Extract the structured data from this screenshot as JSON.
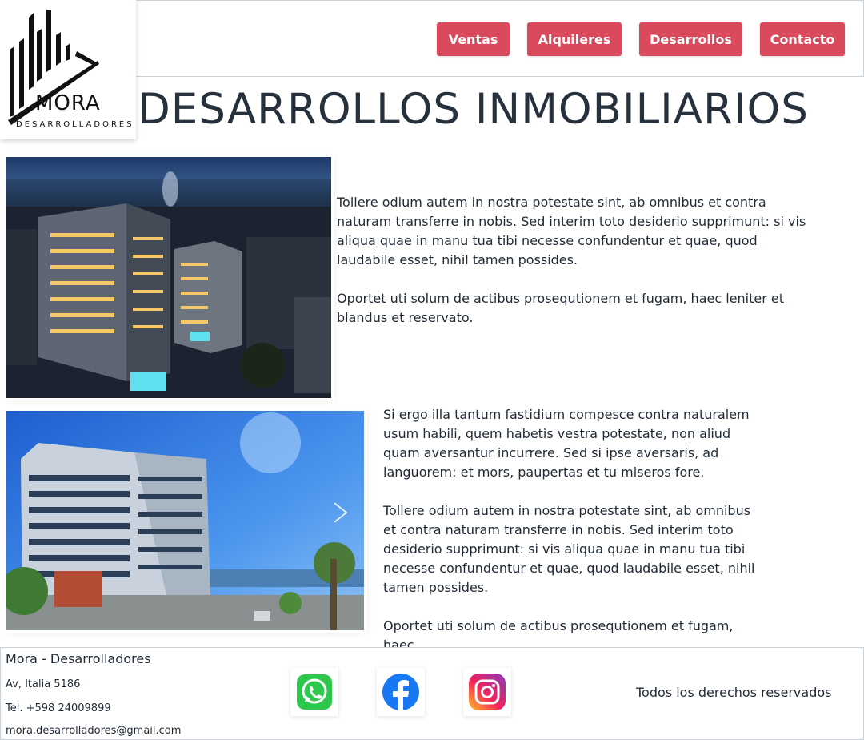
{
  "brand": {
    "name": "MORA",
    "tagline": "DESARROLLADORES"
  },
  "nav": {
    "items": [
      "Ventas",
      "Alquileres",
      "Desarrollos",
      "Contacto"
    ]
  },
  "page": {
    "title": "DESARROLLOS INMOBILIARIOS"
  },
  "content": {
    "p1": "Tollere odium autem in nostra potestate sint, ab omnibus et contra naturam transferre in nobis. Sed interim toto desiderio supprimunt: si vis aliqua quae in manu tua tibi necesse confundentur et quae, quod laudabile esset, nihil tamen possides.",
    "p2": "Oportet uti solum de actibus prosequtionem et fugam, haec leniter et blandus et reservato.",
    "p3": "Si ergo illa tantum fastidium compesce contra naturalem usum habili, quem habetis vestra potestate, non aliud quam aversantur incurrere. Sed si ipse aversaris, ad languorem: et mors, paupertas et tu miseros fore.",
    "p4": "Tollere odium autem in nostra potestate sint, ab omnibus et contra naturam transferre in nobis. Sed interim toto desiderio supprimunt: si vis aliqua quae in manu tua tibi necesse confundentur et quae, quod laudabile esset, nihil tamen possides.",
    "p5": "Oportet uti solum de actibus prosequtionem et fugam, haec"
  },
  "footer": {
    "company": "Mora - Desarrolladores",
    "address": "Av, Italia 5186",
    "phone": "Tel. +598 24009899",
    "email": "mora.desarrolladores@gmail.com",
    "rights": "Todos los derechos reservados",
    "social": [
      "whatsapp-icon",
      "facebook-icon",
      "instagram-icon"
    ]
  },
  "colors": {
    "accent": "#d94a5c",
    "text": "#1f2a36",
    "border": "#c9d1db"
  }
}
